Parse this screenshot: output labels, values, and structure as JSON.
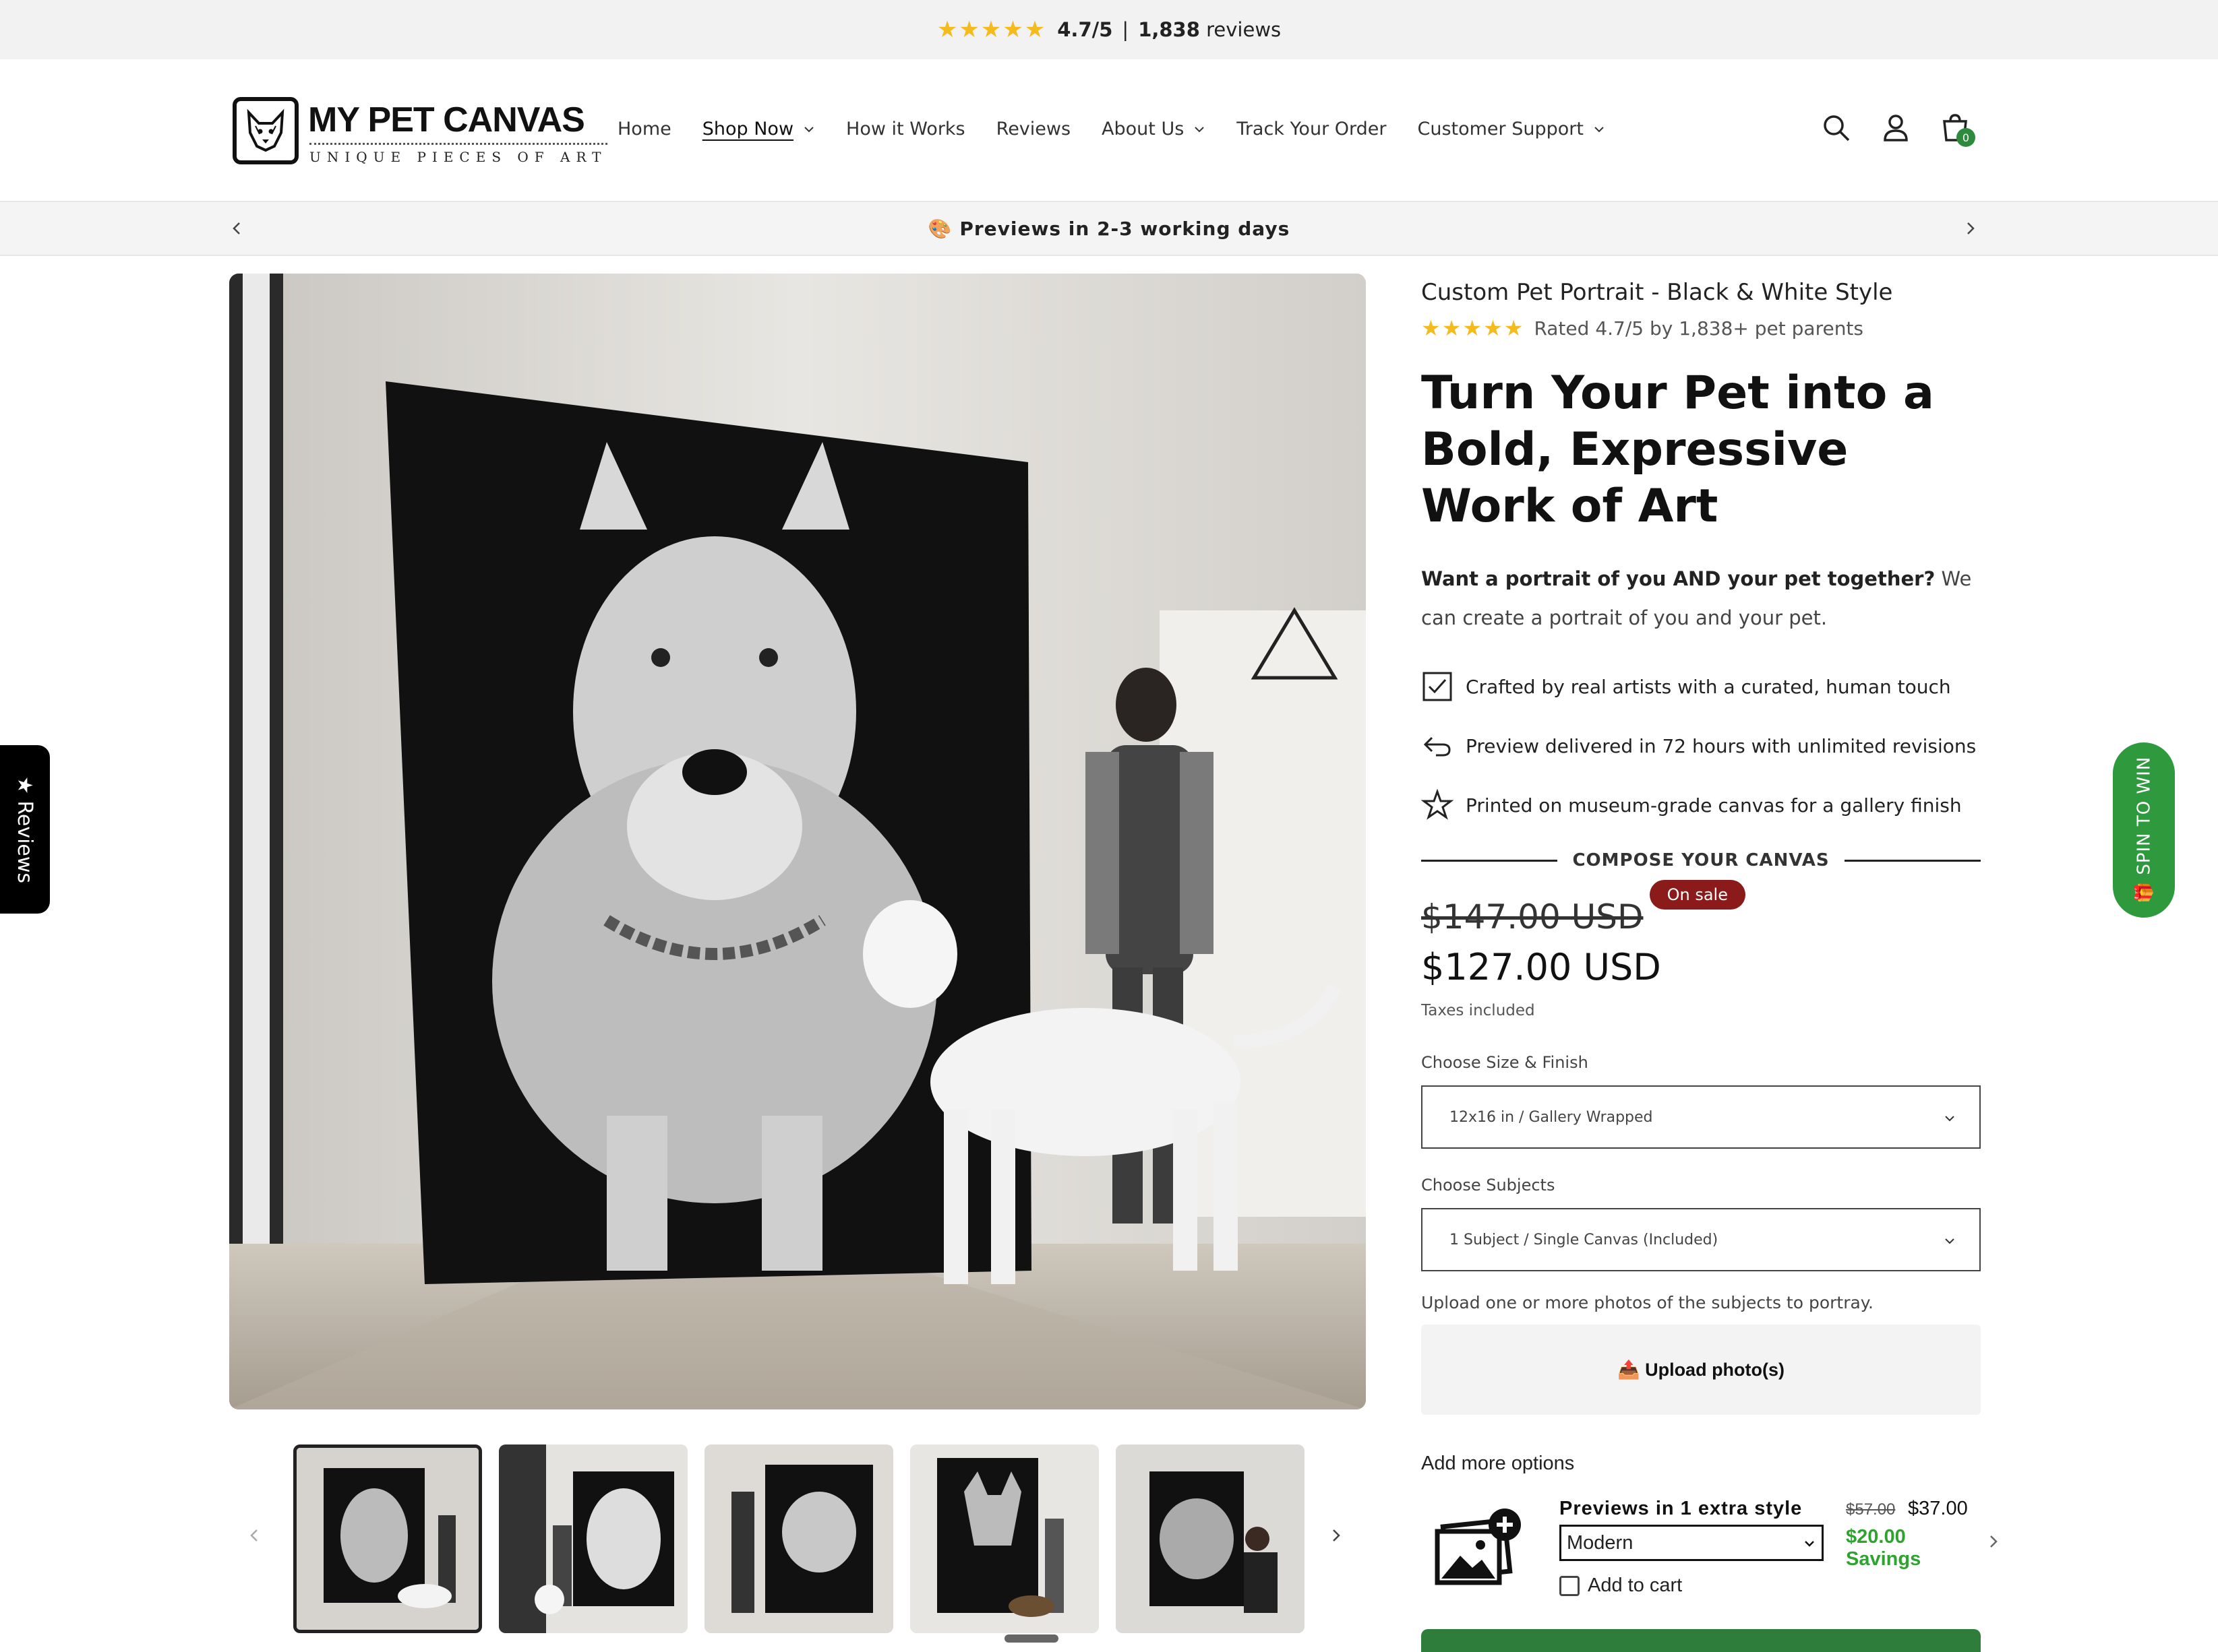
{
  "topbar": {
    "stars": "★★★★★",
    "score": "4.7/5",
    "separator": "|",
    "count": "1,838",
    "reviews_word": "reviews"
  },
  "logo": {
    "title": "MY PET CANVAS",
    "tagline": "UNIQUE PIECES OF ART"
  },
  "nav": [
    {
      "label": "Home",
      "dropdown": false
    },
    {
      "label": "Shop Now",
      "dropdown": true,
      "active": true
    },
    {
      "label": "How it Works",
      "dropdown": false
    },
    {
      "label": "Reviews",
      "dropdown": false
    },
    {
      "label": "About Us",
      "dropdown": true
    },
    {
      "label": "Track Your Order",
      "dropdown": false
    },
    {
      "label": "Customer Support",
      "dropdown": true
    }
  ],
  "header_icons": [
    "search-icon",
    "account-icon",
    "cart-icon"
  ],
  "cart": {
    "count": "0"
  },
  "announcement": {
    "text": "🎨 Previews in 2-3 working days"
  },
  "product": {
    "name": "Custom Pet Portrait - Black & White Style",
    "rating_stars": "★★★★★",
    "rating_text": "Rated 4.7/5 by 1,838+ pet parents",
    "headline": "Turn Your Pet into a Bold, Expressive Work of Art",
    "intro_bold": "Want a portrait of you AND your pet together?",
    "intro_rest": " We can create a portrait of you and your pet.",
    "features": [
      "Crafted by real artists with a curated, human touch",
      "Preview delivered in 72 hours with unlimited revisions",
      "Printed on museum-grade canvas for a gallery finish"
    ],
    "compose_label": "COMPOSE YOUR CANVAS",
    "price_old": "$147.00 USD",
    "sale_badge": "On sale",
    "price_new": "$127.00 USD",
    "taxes": "Taxes included",
    "size_label": "Choose Size & Finish",
    "size_value": "12x16 in / Gallery Wrapped",
    "subjects_label": "Choose Subjects",
    "subjects_value": "1 Subject / Single Canvas (Included)",
    "upload_note": "Upload one or more photos of the subjects to portray.",
    "upload_button": "📤 Upload photo(s)",
    "add_more": "Add more options",
    "upsell": {
      "title": "Previews in 1 extra style",
      "style_value": "Modern",
      "old_price": "$57.00",
      "new_price": "$37.00",
      "savings": "$20.00 Savings",
      "checkbox_label": "Add to cart"
    }
  },
  "tabs": {
    "reviews": "★ Reviews",
    "spin": "🎁 SPIN TO WIN"
  },
  "colors": {
    "star": "#f4bb1f",
    "sale_badge": "#8b1a1a",
    "green": "#2e9a3d",
    "savings": "#2fa32f"
  }
}
